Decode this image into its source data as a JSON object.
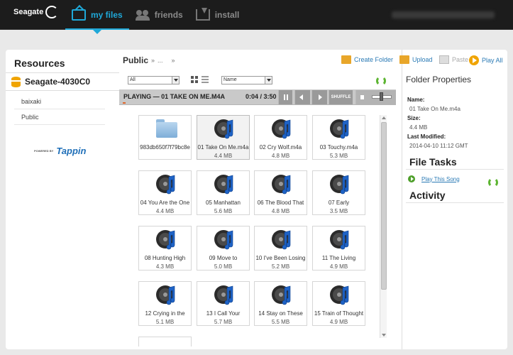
{
  "app": {
    "brand": "Seagate"
  },
  "nav": [
    {
      "label": "my files",
      "icon": "files-icon",
      "active": true
    },
    {
      "label": "friends",
      "icon": "friends-icon",
      "active": false
    },
    {
      "label": "install",
      "icon": "install-icon",
      "active": false
    }
  ],
  "resources": {
    "title": "Resources",
    "device": "Seagate-4030C0",
    "items": [
      "baixaki",
      "Public"
    ],
    "partner": {
      "powered": "POWERED BY",
      "brand": "Tappin"
    }
  },
  "breadcrumb": {
    "current": "Public",
    "sep1": "»",
    "ellipsis": "...",
    "sep2": "»"
  },
  "filters": {
    "type": "All",
    "sort": "Name"
  },
  "player": {
    "now_playing": "PLAYING — 01 TAKE ON ME.M4A",
    "time": "0:04 / 3:50",
    "shuffle": "SHUFFLE",
    "progress": 0.017
  },
  "actions": {
    "create_folder": "Create Folder",
    "upload": "Upload",
    "paste": "Paste",
    "play_all": "Play All"
  },
  "files": [
    {
      "name": "983db650f7f79bc8e",
      "size": "",
      "type": "folder"
    },
    {
      "name": "01 Take On Me.m4a",
      "size": "4.4 MB",
      "type": "audio",
      "selected": true
    },
    {
      "name": "02 Cry Wolf.m4a",
      "size": "4.8 MB",
      "type": "audio"
    },
    {
      "name": "03 Touchy.m4a",
      "size": "5.3 MB",
      "type": "audio"
    },
    {
      "name": "04 You Are the One",
      "size": "4.4 MB",
      "type": "audio"
    },
    {
      "name": "05 Manhattan",
      "size": "5.6 MB",
      "type": "audio"
    },
    {
      "name": "06 The Blood That",
      "size": "4.8 MB",
      "type": "audio"
    },
    {
      "name": "07 Early",
      "size": "3.5 MB",
      "type": "audio"
    },
    {
      "name": "08 Hunting High",
      "size": "4.3 MB",
      "type": "audio"
    },
    {
      "name": "09 Move to",
      "size": "5.0 MB",
      "type": "audio"
    },
    {
      "name": "10 I've Been Losing",
      "size": "5.2 MB",
      "type": "audio"
    },
    {
      "name": "11 The Living",
      "size": "4.9 MB",
      "type": "audio"
    },
    {
      "name": "12 Crying in the",
      "size": "5.1 MB",
      "type": "audio"
    },
    {
      "name": "13 I Call Your",
      "size": "5.7 MB",
      "type": "audio"
    },
    {
      "name": "14 Stay on These",
      "size": "5.5 MB",
      "type": "audio"
    },
    {
      "name": "15 Train of Thought",
      "size": "4.9 MB",
      "type": "audio"
    }
  ],
  "properties": {
    "title": "Folder Properties",
    "name_label": "Name:",
    "name_value": "01 Take On Me.m4a",
    "size_label": "Size:",
    "size_value": "4.4 MB",
    "modified_label": "Last Modified:",
    "modified_value": "2014-04-10 11:12 GMT"
  },
  "file_tasks": {
    "title": "File Tasks",
    "play_song": "Play This Song"
  },
  "activity": {
    "title": "Activity"
  },
  "colors": {
    "accent": "#1fa8d8",
    "link": "#2a7ab5",
    "refresh": "#5db532",
    "progress": "#e0662a"
  }
}
